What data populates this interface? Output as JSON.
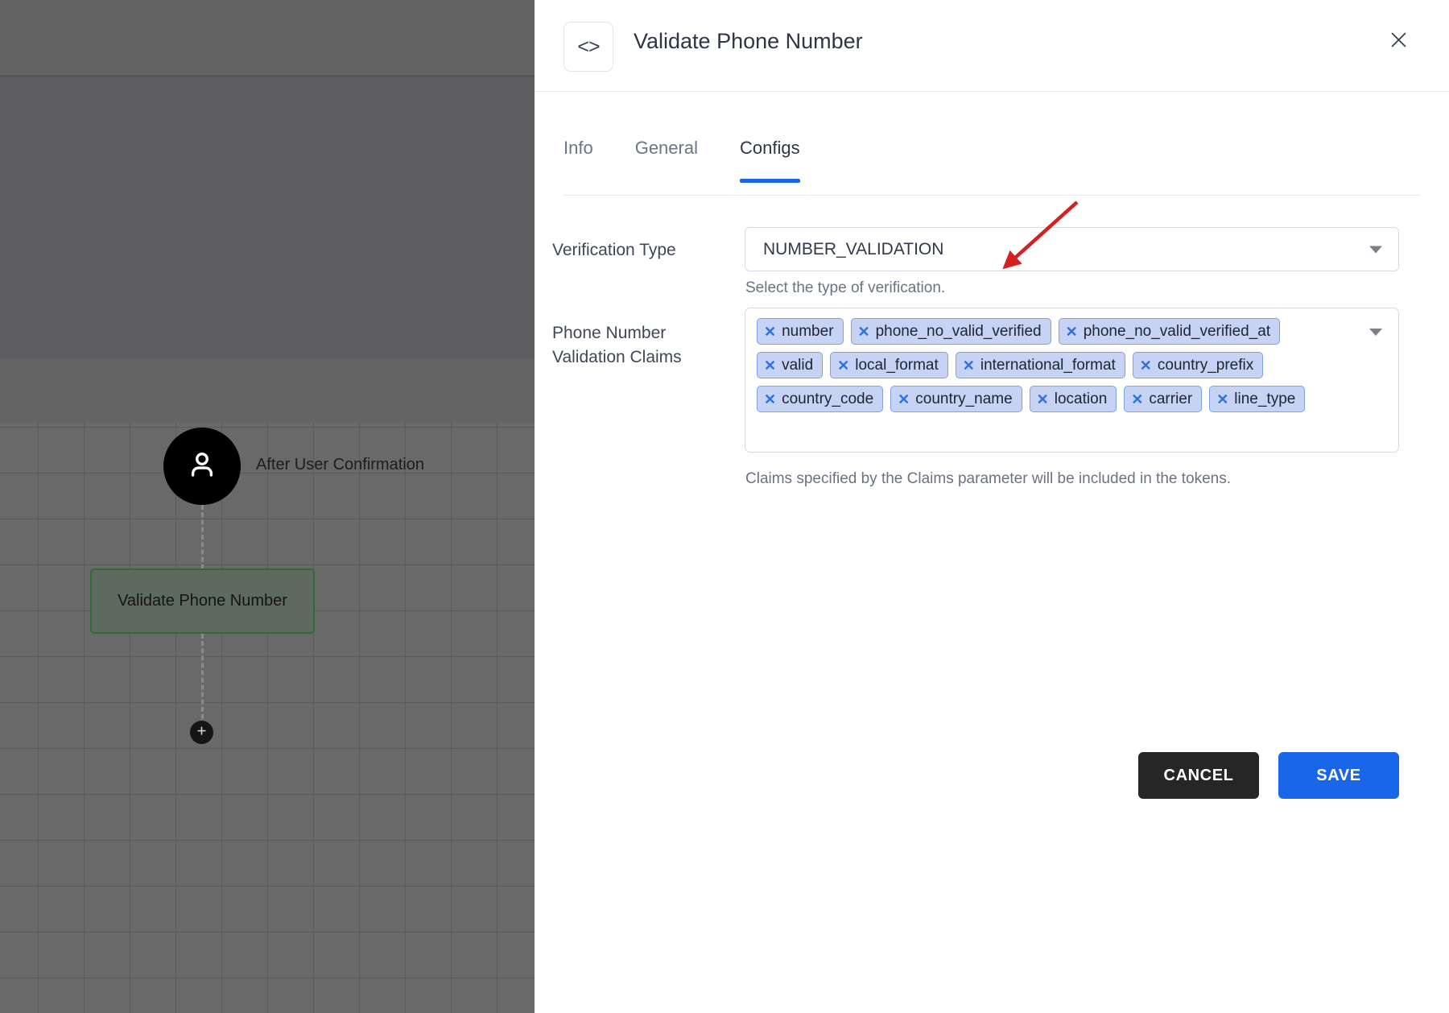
{
  "canvas": {
    "user_node": {
      "icon": "user-icon",
      "label": "After User Confirmation"
    },
    "flow_node": {
      "label": "Validate Phone Number"
    },
    "add_button": {
      "icon": "plus-icon"
    }
  },
  "panel": {
    "header": {
      "icon": "code-icon",
      "icon_glyph": "<>",
      "title": "Validate Phone Number",
      "close_icon": "close-icon"
    },
    "tabs": [
      {
        "label": "Info",
        "active": false
      },
      {
        "label": "General",
        "active": false
      },
      {
        "label": "Configs",
        "active": true
      }
    ],
    "fields": {
      "verification_type": {
        "label": "Verification Type",
        "value": "NUMBER_VALIDATION",
        "helper": "Select the type of verification.",
        "caret_icon": "chevron-down-icon"
      },
      "validation_claims": {
        "label": "Phone Number Validation Claims",
        "helper": "Claims specified by the Claims parameter will be included in the tokens.",
        "caret_icon": "chevron-down-icon",
        "chips": [
          "number",
          "phone_no_valid_verified",
          "phone_no_valid_verified_at",
          "valid",
          "local_format",
          "international_format",
          "country_prefix",
          "country_code",
          "country_name",
          "location",
          "carrier",
          "line_type"
        ]
      }
    },
    "actions": {
      "cancel_label": "CANCEL",
      "save_label": "SAVE"
    }
  },
  "colors": {
    "accent_blue": "#1a66e8",
    "cancel_dark": "#262626",
    "chip_bg": "#c6d3f5",
    "chip_border": "#7ea0e8",
    "annotation_red": "#d42222",
    "node_green_border": "#2f6b34"
  }
}
